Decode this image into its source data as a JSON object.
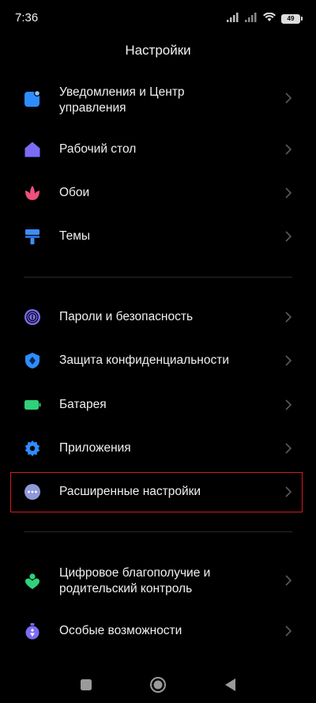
{
  "status_bar": {
    "time": "7:36",
    "battery": "49"
  },
  "header": {
    "title": "Настройки"
  },
  "groups": [
    {
      "items": [
        {
          "label_line1": "Уведомления и Центр",
          "label_line2": "управления",
          "icon": "notifications-icon",
          "color": "#2f8cff"
        },
        {
          "label_line1": "Рабочий стол",
          "label_line2": "",
          "icon": "home-icon",
          "color": "#7b6cf6"
        },
        {
          "label_line1": "Обои",
          "label_line2": "",
          "icon": "flower-icon",
          "color": "#f0507a"
        },
        {
          "label_line1": "Темы",
          "label_line2": "",
          "icon": "brush-icon",
          "color": "#3d8df5"
        }
      ]
    },
    {
      "items": [
        {
          "label_line1": "Пароли и безопасность",
          "label_line2": "",
          "icon": "fingerprint-icon",
          "color": "#7b6cf6"
        },
        {
          "label_line1": "Защита конфиденциальности",
          "label_line2": "",
          "icon": "privacy-shield-icon",
          "color": "#2f8cff"
        },
        {
          "label_line1": "Батарея",
          "label_line2": "",
          "icon": "battery-icon",
          "color": "#2fd17a"
        },
        {
          "label_line1": "Приложения",
          "label_line2": "",
          "icon": "gear-icon",
          "color": "#2f8cff"
        },
        {
          "label_line1": "Расширенные настройки",
          "label_line2": "",
          "icon": "more-dots-icon",
          "color": "#8f99d9"
        }
      ]
    },
    {
      "items": [
        {
          "label_line1": "Цифровое благополучие и",
          "label_line2": "родительский контроль",
          "icon": "wellbeing-icon",
          "color": "#2fd17a"
        },
        {
          "label_line1": "Особые возможности",
          "label_line2": "",
          "icon": "accessibility-icon",
          "color": "#7b6cf6"
        }
      ]
    }
  ],
  "highlighted_item": "Расширенные настройки",
  "colors": {
    "background": "#000000",
    "highlight": "#d71920",
    "chevron": "#5a5a5a"
  }
}
